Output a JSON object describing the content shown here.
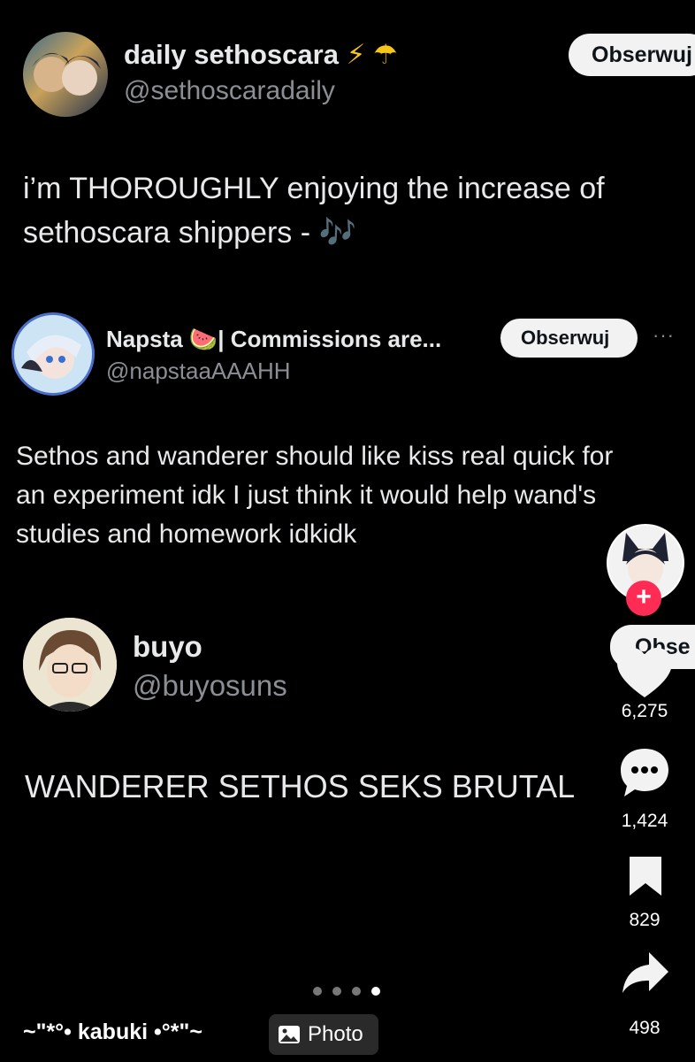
{
  "posts": [
    {
      "name": "daily sethoscara",
      "emoji": "⚡ ☂",
      "handle": "@sethoscaradaily",
      "follow_label": "Obserwuj",
      "text_lines": [
        "i’m THOROUGHLY enjoying the increase of",
        "sethoscara shippers - 🎶"
      ]
    },
    {
      "name": "Napsta 🍉| Commissions are...",
      "handle": "@napstaaAAAHH",
      "follow_label": "Obserwuj",
      "more_label": "···",
      "text_lines": [
        "Sethos and wanderer should like kiss real quick for",
        "an experiment idk I just think it would help wand's",
        "studies and homework idkidk"
      ]
    },
    {
      "name": "buyo",
      "handle": "@buyosuns",
      "follow_label": "Obse",
      "text_lines": [
        "WANDERER SETHOS SEKS BRUTAL"
      ]
    }
  ],
  "rail": {
    "follow_plus": "+",
    "likes": "6,275",
    "comments": "1,424",
    "saves": "829",
    "shares": "498"
  },
  "footer": {
    "username": "~\"*°• kabuki •°*\"~",
    "photo_label": "Photo"
  },
  "carousel": {
    "count": 4,
    "active": 4
  }
}
